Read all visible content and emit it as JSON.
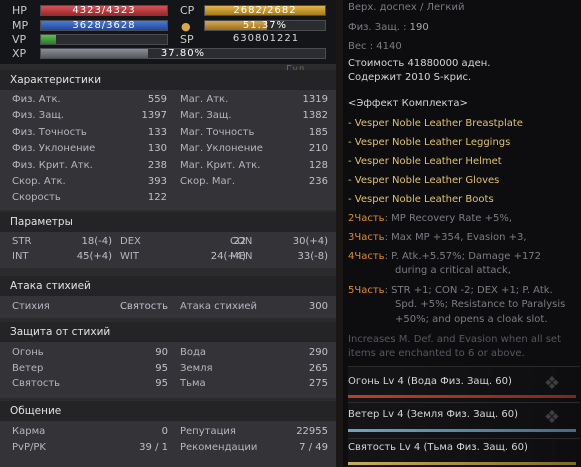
{
  "status": {
    "hp_label": "HP",
    "hp": "4323/4323",
    "hp_fill": 1.0,
    "mp_label": "MP",
    "mp": "3628/3628",
    "mp_fill": 1.0,
    "vp_label": "VP",
    "vp_fill": 0.12,
    "xp_label": "XP",
    "xp": "37.80%",
    "xp_fill": 0.378,
    "cp_label": "CP",
    "cp": "2682/2682",
    "cp_fill": 1.0,
    "weight": "51.37%",
    "weight_fill": 0.5137,
    "sp_label": "SP",
    "sp": "630801221",
    "bg_text": "Гул"
  },
  "characteristics": {
    "title": "Характеристики",
    "left": [
      [
        "Физ. Атк.",
        "559"
      ],
      [
        "Физ. Защ.",
        "1397"
      ],
      [
        "Физ. Точность",
        "133"
      ],
      [
        "Физ. Уклонение",
        "130"
      ],
      [
        "Физ. Крит. Атк.",
        "238"
      ],
      [
        "Скор. Атк.",
        "393"
      ],
      [
        "Скорость",
        "122"
      ]
    ],
    "right": [
      [
        "Маг. Атк.",
        "1319"
      ],
      [
        "Маг. Защ.",
        "1382"
      ],
      [
        "Маг. Точность",
        "185"
      ],
      [
        "Маг. Уклонение",
        "210"
      ],
      [
        "Маг. Крит. Атк.",
        "128"
      ],
      [
        "Скор. Маг.",
        "236"
      ]
    ]
  },
  "params": {
    "title": "Параметры",
    "rows": [
      [
        [
          "STR",
          "18(-4)"
        ],
        [
          "DEX",
          "22"
        ],
        [
          "CON",
          "30(+4)"
        ]
      ],
      [
        [
          "INT",
          "45(+4)"
        ],
        [
          "WIT",
          "24(+4)"
        ],
        [
          "MEN",
          "33(-8)"
        ]
      ]
    ]
  },
  "attack_elem": {
    "title": "Атака стихией",
    "label1": "Стихия",
    "value1": "Святость",
    "label2": "Атака стихией",
    "value2": "300"
  },
  "defense_elem": {
    "title": "Защита от стихий",
    "left": [
      [
        "Огонь",
        "90"
      ],
      [
        "Ветер",
        "95"
      ],
      [
        "Святость",
        "95"
      ]
    ],
    "right": [
      [
        "Вода",
        "290"
      ],
      [
        "Земля",
        "265"
      ],
      [
        "Тьма",
        "275"
      ]
    ]
  },
  "social": {
    "title": "Общение",
    "left": [
      [
        "Карма",
        "0"
      ],
      [
        "PvP/PK",
        "39 / 1"
      ]
    ],
    "right": [
      [
        "Репутация",
        "22955"
      ],
      [
        "Рекомендации",
        "7 / 49"
      ]
    ]
  },
  "tooltip": {
    "type": "Верх. доспех / Легкий",
    "pdef_label": "Физ. Защ. :",
    "pdef": "190",
    "weight_label": "Вес :",
    "weight": "4140",
    "price": "Стоимость 41880000 аден.",
    "crystals": "Содержит 2010 S-крис.",
    "set_title": "<Эффект Комплекта>",
    "set_items": [
      "- Vesper Noble Leather Breastplate",
      "- Vesper Noble Leather Leggings",
      "- Vesper Noble Leather Helmet",
      "- Vesper Noble Leather Gloves",
      "- Vesper Noble Leather Boots"
    ],
    "p2_label": "2Часть",
    "p2": ": MP Recovery Rate +5%,",
    "p3_label": "3Часть",
    "p3": ": Max MP +354, Evasion +3,",
    "p4_label": "4Часть",
    "p4a": ": P. Atk.+5.57%; Damage +172",
    "p4b": "during a critical attack,",
    "p5_label": "5Часть",
    "p5a": ": STR +1; CON -2;  DEX +1; P. Atk.",
    "p5b": "Spd. +5%; Resistance to Paralysis",
    "p5c": "+50%; and opens a cloak slot.",
    "enchant_a": "Increases M. Def. and Evasion when all set",
    "enchant_b": "items are enchanted to 6 or above.",
    "attr1": "Огонь Lv 4 (Вода Физ. Защ. 60)",
    "attr2": "Ветер Lv 4 (Земля Физ. Защ. 60)",
    "attr3": "Святость Lv 4 (Тьма Физ. Защ. 60)"
  },
  "colors": {
    "hp": "#b8383c",
    "mp": "#2f5fb8",
    "vp": "#3d9a3a",
    "xp": "#6a6d74",
    "cp": "#c79a2a"
  }
}
